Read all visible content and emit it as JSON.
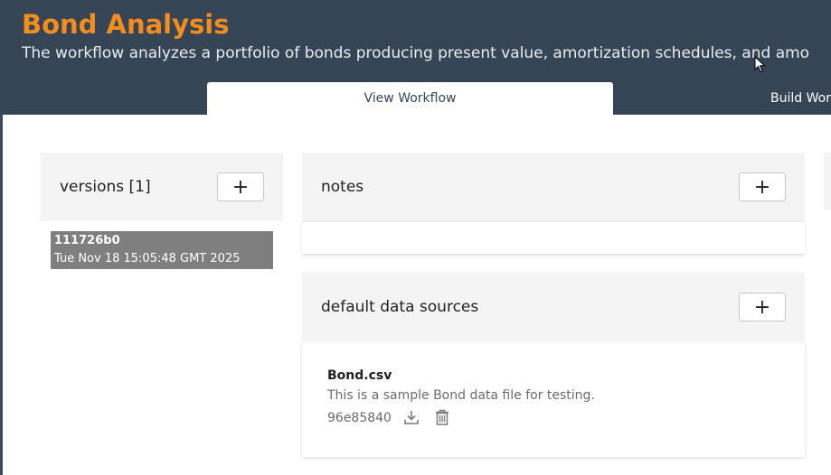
{
  "header": {
    "title": "Bond Analysis",
    "subtitle": "The workflow analyzes a portfolio of bonds producing present value, amortization schedules, and amo",
    "bg_color": "#364556",
    "title_color": "#f28c1e"
  },
  "tabs": [
    {
      "label": "View Workflow",
      "active": true
    },
    {
      "label": "Build Wor",
      "active": false
    }
  ],
  "versions": {
    "title": "versions [1]",
    "add_label": "+",
    "items": [
      {
        "id": "111726b0",
        "date": "Tue Nov 18 15:05:48 GMT 2025",
        "selected": true
      }
    ]
  },
  "notes": {
    "title": "notes",
    "add_label": "+"
  },
  "data_sources": {
    "title": "default data sources",
    "add_label": "+",
    "items": [
      {
        "name": "Bond.csv",
        "description": "This is a sample Bond data file for testing.",
        "hash": "96e85840",
        "download_icon": "download-icon",
        "delete_icon": "trash-icon"
      }
    ]
  }
}
